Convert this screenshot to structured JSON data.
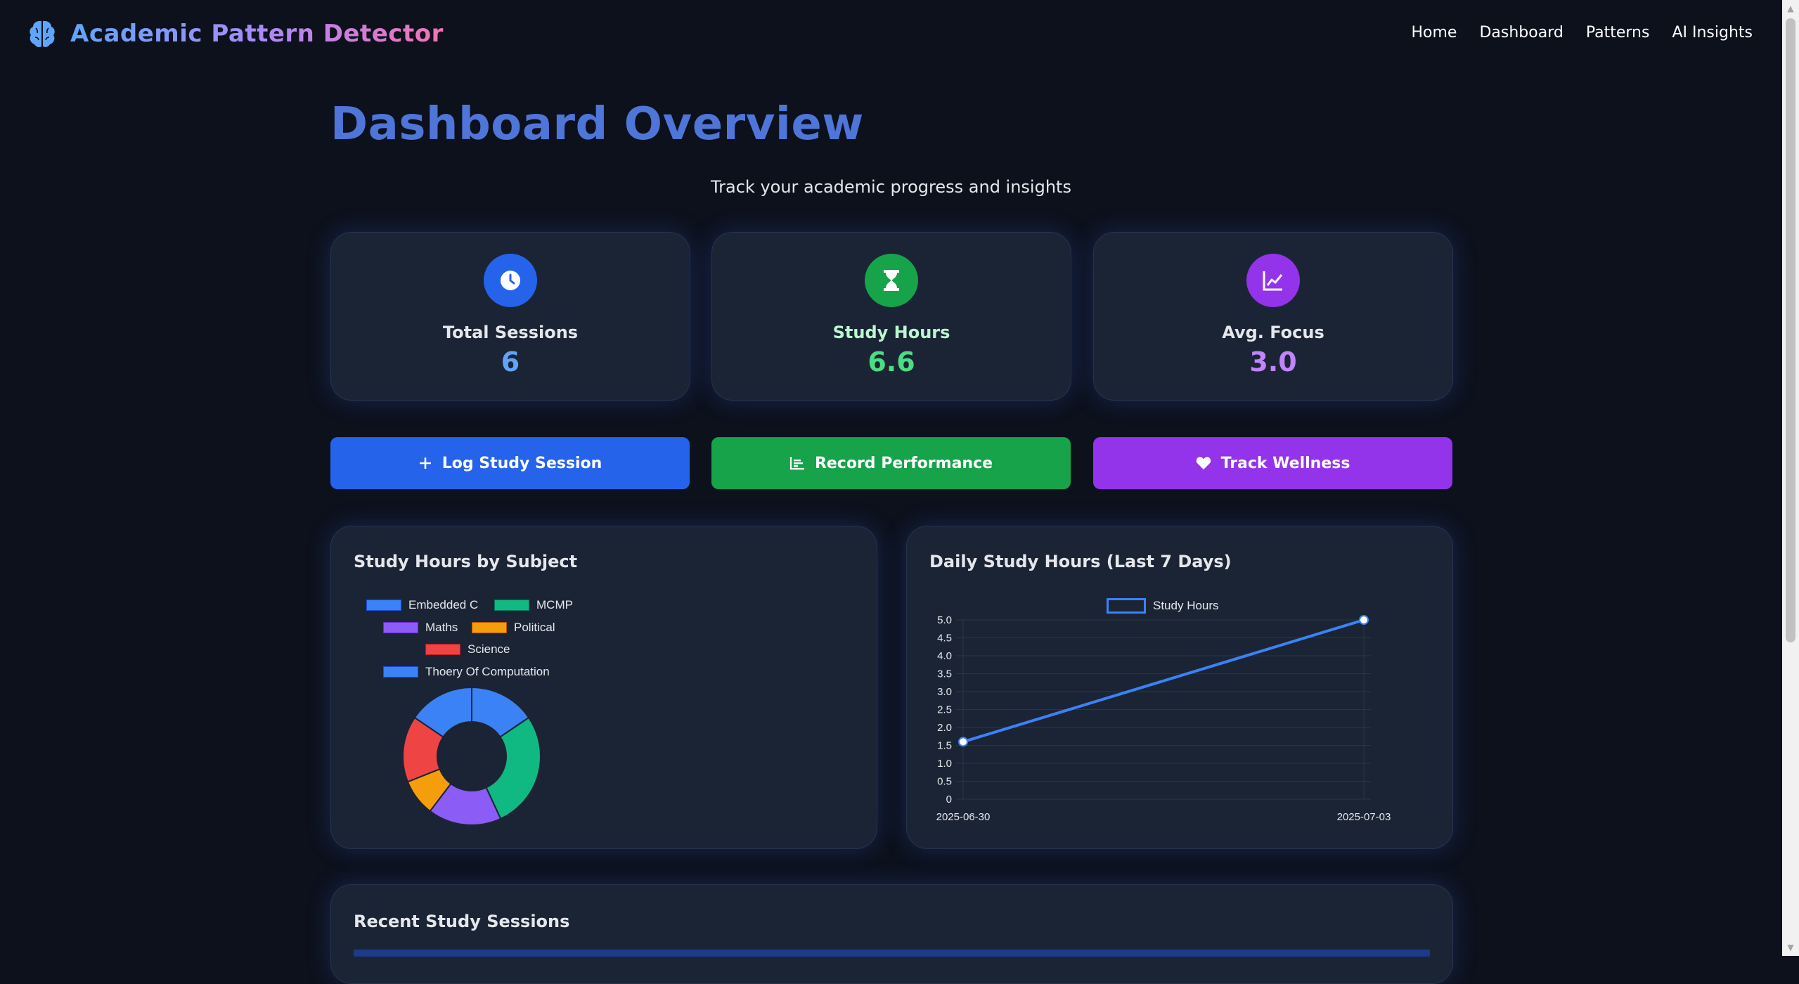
{
  "app": {
    "title": "Academic Pattern Detector"
  },
  "nav": {
    "items": [
      "Home",
      "Dashboard",
      "Patterns",
      "AI Insights"
    ]
  },
  "header": {
    "title": "Dashboard Overview",
    "subtitle": "Track your academic progress and insights"
  },
  "stats": [
    {
      "label": "Total Sessions",
      "value": "6",
      "icon": "clock-icon",
      "color": "#2563eb",
      "value_color": "#60a5fa"
    },
    {
      "label": "Study Hours",
      "value": "6.6",
      "icon": "hourglass-icon",
      "color": "#16a34a",
      "value_color": "#4ade80"
    },
    {
      "label": "Avg. Focus",
      "value": "3.0",
      "icon": "chart-line-icon",
      "color": "#9333ea",
      "value_color": "#c084fc"
    }
  ],
  "actions": [
    {
      "label": "Log Study Session",
      "icon": "plus-icon",
      "color": "#2563eb"
    },
    {
      "label": "Record Performance",
      "icon": "bar-chart-icon",
      "color": "#16a34a"
    },
    {
      "label": "Track Wellness",
      "icon": "heart-icon",
      "color": "#9333ea"
    }
  ],
  "charts": {
    "subject_title": "Study Hours by Subject",
    "daily_title": "Daily Study Hours (Last 7 Days)"
  },
  "chart_data": [
    {
      "type": "pie",
      "title": "Study Hours by Subject",
      "categories": [
        "Embedded C",
        "MCMP",
        "Maths",
        "Political",
        "Science",
        "Thoery Of Computation"
      ],
      "values": [
        0.9,
        1.6,
        1.0,
        0.5,
        0.9,
        0.9
      ],
      "colors": [
        "#3b82f6",
        "#10b981",
        "#8b5cf6",
        "#f59e0b",
        "#ef4444",
        "#3b82f6"
      ],
      "legend": "top"
    },
    {
      "type": "line",
      "title": "Daily Study Hours (Last 7 Days)",
      "x": [
        "2025-06-30",
        "2025-07-03"
      ],
      "series": [
        {
          "name": "Study Hours",
          "values": [
            1.6,
            5.0
          ],
          "color": "#3b82f6"
        }
      ],
      "yticks": [
        "0",
        "0.5",
        "1.0",
        "1.5",
        "2.0",
        "2.5",
        "3.0",
        "3.5",
        "4.0",
        "4.5",
        "5.0"
      ],
      "ylim": [
        0,
        5
      ],
      "grid": true,
      "legend": "top"
    }
  ],
  "sessions": {
    "title": "Recent Study Sessions"
  }
}
